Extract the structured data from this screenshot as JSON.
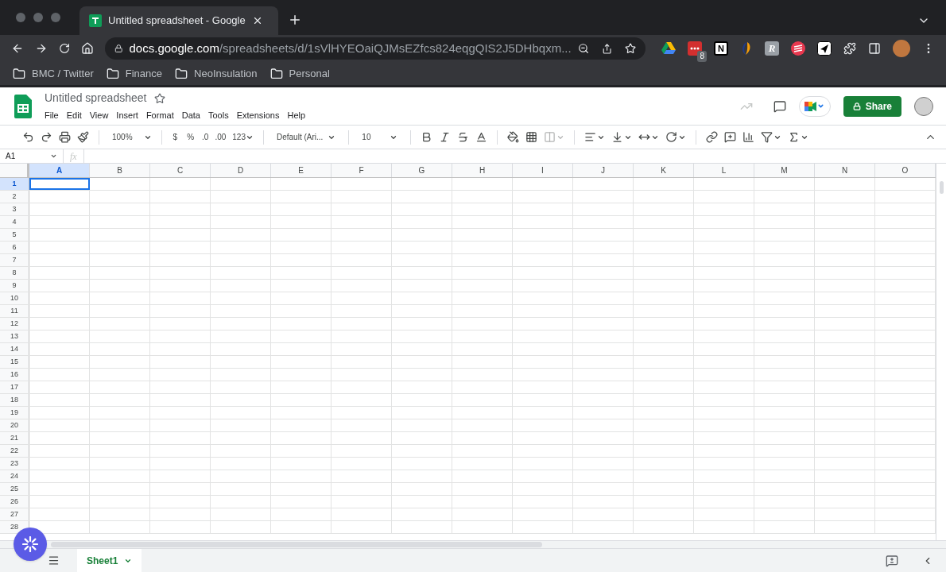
{
  "browser": {
    "tab": {
      "title": "Untitled spreadsheet - Google",
      "selected": true
    },
    "url": {
      "host": "docs.google.com",
      "path": "/spreadsheets/d/1sVlHYEOaiQJMsEZfcs824eqgQIS2J5DHbqxm..."
    },
    "extensions": [
      {
        "kind": "drive"
      },
      {
        "kind": "dots",
        "badge": "8"
      },
      {
        "kind": "notion",
        "label": "N"
      },
      {
        "kind": "swirl"
      },
      {
        "kind": "letter",
        "label": "R"
      },
      {
        "kind": "stripes"
      },
      {
        "kind": "send"
      }
    ],
    "bookmarks": [
      "BMC / Twitter",
      "Finance",
      "NeoInsulation",
      "Personal"
    ]
  },
  "doc": {
    "title": "Untitled spreadsheet",
    "menu": [
      "File",
      "Edit",
      "View",
      "Insert",
      "Format",
      "Data",
      "Tools",
      "Extensions",
      "Help"
    ],
    "share": "Share"
  },
  "toolbar": {
    "zoom": "100%",
    "currency": "$",
    "percent": "%",
    "decrease_decimals": ".0",
    "increase_decimals": ".00",
    "number_format": "123",
    "font": "Default (Ari...",
    "font_size": "10"
  },
  "formula_bar": {
    "name_box": "A1",
    "fx": "fx"
  },
  "grid": {
    "columns": [
      {
        "label": "A",
        "selected": true
      },
      {
        "label": "B",
        "selected": false
      },
      {
        "label": "C",
        "selected": false
      },
      {
        "label": "D",
        "selected": false
      },
      {
        "label": "E",
        "selected": false
      },
      {
        "label": "F",
        "selected": false
      },
      {
        "label": "G",
        "selected": false
      },
      {
        "label": "H",
        "selected": false
      },
      {
        "label": "I",
        "selected": false
      },
      {
        "label": "J",
        "selected": false
      },
      {
        "label": "K",
        "selected": false
      },
      {
        "label": "L",
        "selected": false
      },
      {
        "label": "M",
        "selected": false
      },
      {
        "label": "N",
        "selected": false
      },
      {
        "label": "O",
        "selected": false
      }
    ],
    "rows": [
      {
        "label": "1",
        "selected": true
      },
      {
        "label": "2",
        "selected": false
      },
      {
        "label": "3",
        "selected": false
      },
      {
        "label": "4",
        "selected": false
      },
      {
        "label": "5",
        "selected": false
      },
      {
        "label": "6",
        "selected": false
      },
      {
        "label": "7",
        "selected": false
      },
      {
        "label": "8",
        "selected": false
      },
      {
        "label": "9",
        "selected": false
      },
      {
        "label": "10",
        "selected": false
      },
      {
        "label": "11",
        "selected": false
      },
      {
        "label": "12",
        "selected": false
      },
      {
        "label": "13",
        "selected": false
      },
      {
        "label": "14",
        "selected": false
      },
      {
        "label": "15",
        "selected": false
      },
      {
        "label": "16",
        "selected": false
      },
      {
        "label": "17",
        "selected": false
      },
      {
        "label": "18",
        "selected": false
      },
      {
        "label": "19",
        "selected": false
      },
      {
        "label": "20",
        "selected": false
      },
      {
        "label": "21",
        "selected": false
      },
      {
        "label": "22",
        "selected": false
      },
      {
        "label": "23",
        "selected": false
      },
      {
        "label": "24",
        "selected": false
      },
      {
        "label": "25",
        "selected": false
      },
      {
        "label": "26",
        "selected": false
      },
      {
        "label": "27",
        "selected": false
      },
      {
        "label": "28",
        "selected": false
      }
    ]
  },
  "sheets": [
    {
      "name": "Sheet1",
      "selected": true
    }
  ]
}
